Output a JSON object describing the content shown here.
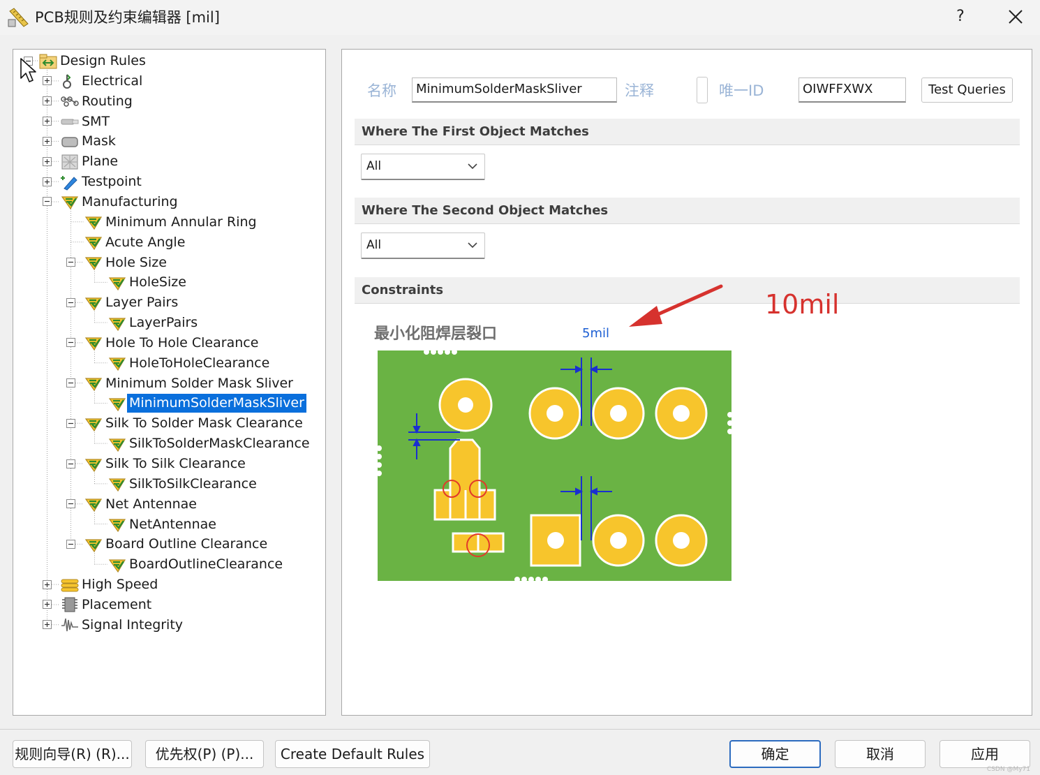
{
  "window": {
    "title": "PCB规则及约束编辑器 [mil]",
    "help": "?"
  },
  "tree": [
    {
      "label": "Design Rules",
      "level": 0,
      "expander": "minus",
      "icon": "design-rules-icon"
    },
    {
      "label": "Electrical",
      "level": 1,
      "expander": "plus",
      "icon": "electrical-icon"
    },
    {
      "label": "Routing",
      "level": 1,
      "expander": "plus",
      "icon": "routing-icon"
    },
    {
      "label": "SMT",
      "level": 1,
      "expander": "plus",
      "icon": "smt-icon"
    },
    {
      "label": "Mask",
      "level": 1,
      "expander": "plus",
      "icon": "mask-icon"
    },
    {
      "label": "Plane",
      "level": 1,
      "expander": "plus",
      "icon": "plane-icon"
    },
    {
      "label": "Testpoint",
      "level": 1,
      "expander": "plus",
      "icon": "testpoint-icon"
    },
    {
      "label": "Manufacturing",
      "level": 1,
      "expander": "minus",
      "icon": "rule-icon"
    },
    {
      "label": "Minimum Annular Ring",
      "level": 2,
      "expander": "none",
      "icon": "rule-icon"
    },
    {
      "label": "Acute Angle",
      "level": 2,
      "expander": "none",
      "icon": "rule-icon"
    },
    {
      "label": "Hole Size",
      "level": 2,
      "expander": "minus",
      "icon": "rule-icon"
    },
    {
      "label": "HoleSize",
      "level": 3,
      "expander": "none",
      "icon": "rule-icon"
    },
    {
      "label": "Layer Pairs",
      "level": 2,
      "expander": "minus",
      "icon": "rule-icon"
    },
    {
      "label": "LayerPairs",
      "level": 3,
      "expander": "none",
      "icon": "rule-icon"
    },
    {
      "label": "Hole To Hole Clearance",
      "level": 2,
      "expander": "minus",
      "icon": "rule-icon"
    },
    {
      "label": "HoleToHoleClearance",
      "level": 3,
      "expander": "none",
      "icon": "rule-icon"
    },
    {
      "label": "Minimum Solder Mask Sliver",
      "level": 2,
      "expander": "minus",
      "icon": "rule-icon"
    },
    {
      "label": "MinimumSolderMaskSliver",
      "level": 3,
      "expander": "none",
      "icon": "rule-icon",
      "selected": true
    },
    {
      "label": "Silk To Solder Mask Clearance",
      "level": 2,
      "expander": "minus",
      "icon": "rule-icon"
    },
    {
      "label": "SilkToSolderMaskClearance",
      "level": 3,
      "expander": "none",
      "icon": "rule-icon"
    },
    {
      "label": "Silk To Silk Clearance",
      "level": 2,
      "expander": "minus",
      "icon": "rule-icon"
    },
    {
      "label": "SilkToSilkClearance",
      "level": 3,
      "expander": "none",
      "icon": "rule-icon"
    },
    {
      "label": "Net Antennae",
      "level": 2,
      "expander": "minus",
      "icon": "rule-icon"
    },
    {
      "label": "NetAntennae",
      "level": 3,
      "expander": "none",
      "icon": "rule-icon"
    },
    {
      "label": "Board Outline Clearance",
      "level": 2,
      "expander": "minus",
      "icon": "rule-icon"
    },
    {
      "label": "BoardOutlineClearance",
      "level": 3,
      "expander": "none",
      "icon": "rule-icon"
    },
    {
      "label": "High Speed",
      "level": 1,
      "expander": "plus",
      "icon": "high-speed-icon"
    },
    {
      "label": "Placement",
      "level": 1,
      "expander": "plus",
      "icon": "placement-icon"
    },
    {
      "label": "Signal Integrity",
      "level": 1,
      "expander": "plus",
      "icon": "signal-integrity-icon"
    }
  ],
  "rule": {
    "name_label": "名称",
    "name_value": "MinimumSolderMaskSliver",
    "comment_label": "注释",
    "unique_id_label": "唯一ID",
    "unique_id_value": "OIWFFXWX",
    "test_queries": "Test Queries"
  },
  "sections": {
    "first_match": "Where The First Object Matches",
    "first_match_value": "All",
    "second_match": "Where The Second Object Matches",
    "second_match_value": "All",
    "constraints": "Constraints"
  },
  "constraint": {
    "diagram_title": "最小化阻焊层裂口",
    "value": "5mil"
  },
  "annotation": {
    "text": "10mil",
    "color": "#d6322e"
  },
  "buttons": {
    "rule_wizard": "规则向导(R) (R)...",
    "priority": "优先权(P) (P)...",
    "create_default": "Create Default Rules",
    "ok": "确定",
    "cancel": "取消",
    "apply": "应用"
  },
  "watermark": "CSDN @My71",
  "colors": {
    "pcb_green": "#6ab344",
    "pad_yellow": "#f7c52c",
    "selection_blue": "#0a6fdc",
    "dimension_blue": "#1a2fd0"
  }
}
